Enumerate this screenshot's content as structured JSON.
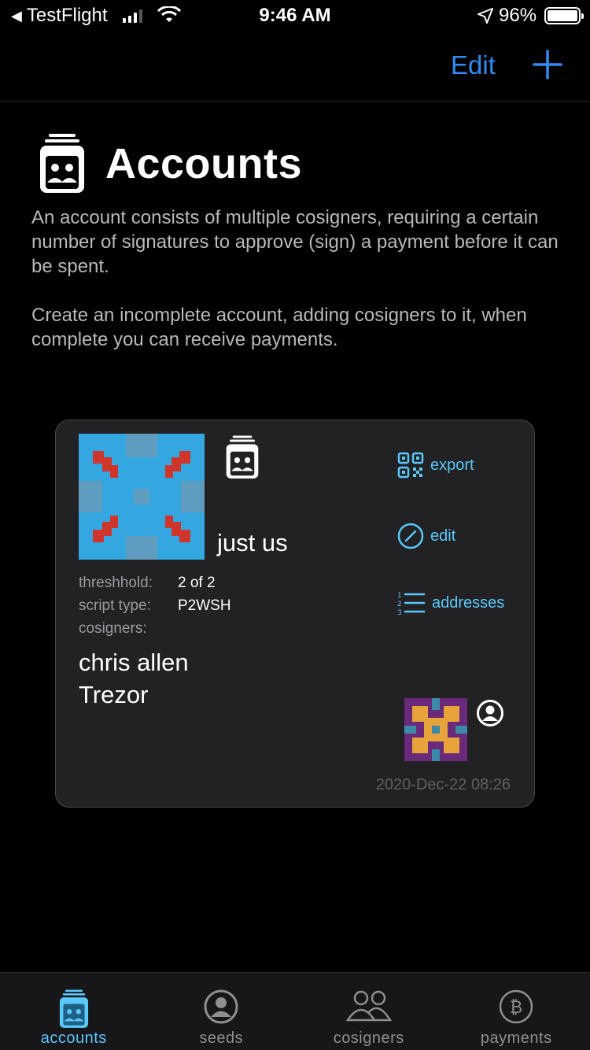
{
  "status_bar": {
    "back_app": "TestFlight",
    "time": "9:46 AM",
    "battery": "96%"
  },
  "nav": {
    "edit_label": "Edit",
    "add_icon": "plus-icon"
  },
  "header": {
    "title": "Accounts",
    "icon": "accounts-icon",
    "description_1": "An account consists of multiple cosigners, requiring a certain number of signatures to approve (sign) a payment before it can be spent.",
    "description_2": "Create an incomplete account, adding cosigners to it, when complete you can receive payments."
  },
  "account_card": {
    "name": "just us",
    "threshold_label": "threshhold:",
    "threshold_value": "2 of 2",
    "script_type_label": "script type:",
    "script_type_value": "P2WSH",
    "cosigners_label": "cosigners:",
    "cosigners": [
      "chris allen",
      "Trezor"
    ],
    "actions": [
      {
        "label": "export",
        "icon": "qr-code-icon"
      },
      {
        "label": "edit",
        "icon": "pencil-circle-icon"
      },
      {
        "label": "addresses",
        "icon": "numbered-list-icon"
      }
    ],
    "date": "2020-Dec-22 08:26",
    "colors": {
      "thumb_base": "#34a7e0",
      "thumb_accent": "#d0352b",
      "thumb2_base": "#e8a33a",
      "thumb2_accent": "#6a2a7a"
    }
  },
  "tabs": [
    {
      "label": "accounts",
      "icon": "accounts-icon",
      "active": true
    },
    {
      "label": "seeds",
      "icon": "person-circle-icon",
      "active": false
    },
    {
      "label": "cosigners",
      "icon": "people-icon",
      "active": false
    },
    {
      "label": "payments",
      "icon": "bitcoin-circle-icon",
      "active": false
    }
  ],
  "accent_color": "#5ac8fa",
  "nav_accent_color": "#2f8cf7"
}
